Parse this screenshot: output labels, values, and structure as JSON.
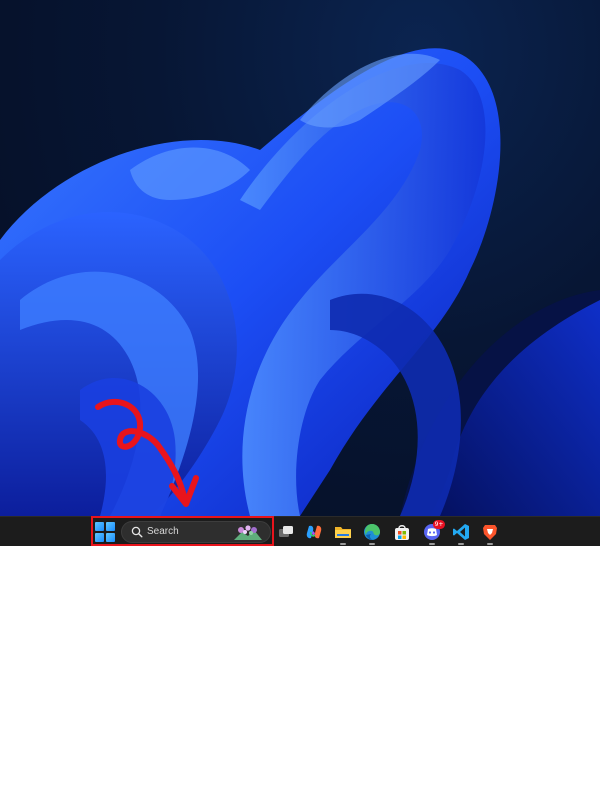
{
  "desktop": {
    "wallpaper": "windows-11-bloom-wallpaper",
    "accent_color": "#1f5bff"
  },
  "taskbar": {
    "start_icon": "windows-logo-icon",
    "search": {
      "label": "Search",
      "icon": "search-icon",
      "highlight_art": "search-highlight-flowers-icon"
    },
    "pinned_apps": [
      {
        "name": "task-view",
        "icon": "task-view-icon"
      },
      {
        "name": "copilot",
        "icon": "copilot-icon"
      },
      {
        "name": "file-explorer",
        "icon": "folder-icon",
        "running": true
      },
      {
        "name": "microsoft-edge",
        "icon": "edge-icon",
        "running": true
      },
      {
        "name": "microsoft-store",
        "icon": "store-icon"
      },
      {
        "name": "discord",
        "icon": "discord-icon",
        "badge": "9+",
        "running": true
      },
      {
        "name": "visual-studio-code",
        "icon": "vscode-icon",
        "running": true
      },
      {
        "name": "brave-browser",
        "icon": "brave-icon",
        "running": true
      }
    ]
  },
  "annotation": {
    "color": "#e8141c",
    "highlight_target": "search-box"
  }
}
